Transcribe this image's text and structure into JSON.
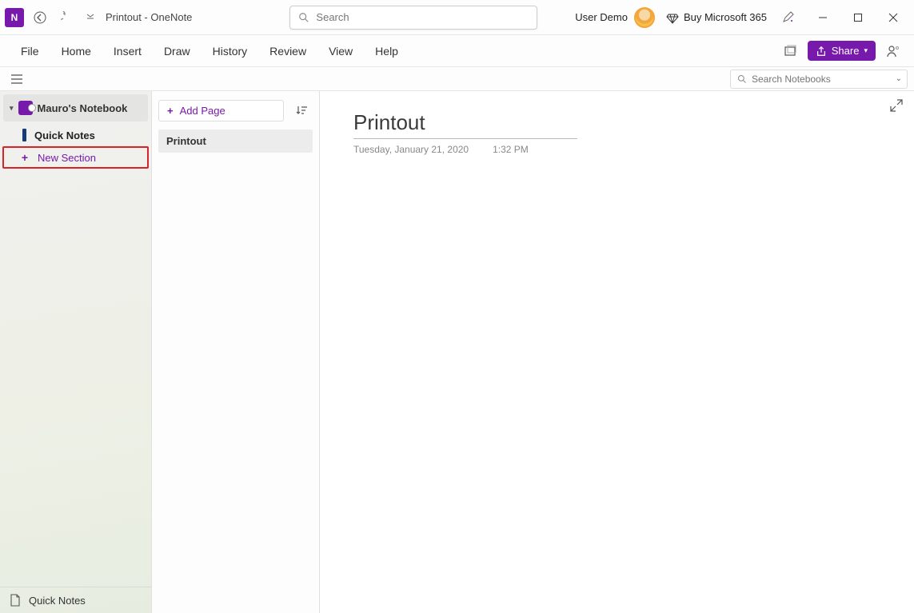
{
  "titlebar": {
    "doc_title": "Printout",
    "app_name": "OneNote",
    "separator": " - ",
    "search_placeholder": "Search",
    "user_name": "User Demo",
    "buy_label": "Buy Microsoft 365"
  },
  "ribbon": {
    "tabs": [
      "File",
      "Home",
      "Insert",
      "Draw",
      "History",
      "Review",
      "View",
      "Help"
    ],
    "share_label": "Share"
  },
  "subbar": {
    "search_notebooks_placeholder": "Search Notebooks"
  },
  "sidebar": {
    "notebook_name": "Mauro's Notebook",
    "quick_notes_label": "Quick Notes",
    "new_section_label": "New Section",
    "footer_label": "Quick Notes"
  },
  "pagelist": {
    "add_page_label": "Add Page",
    "pages": [
      "Printout"
    ]
  },
  "editor": {
    "title": "Printout",
    "date": "Tuesday, January 21, 2020",
    "time": "1:32 PM"
  }
}
